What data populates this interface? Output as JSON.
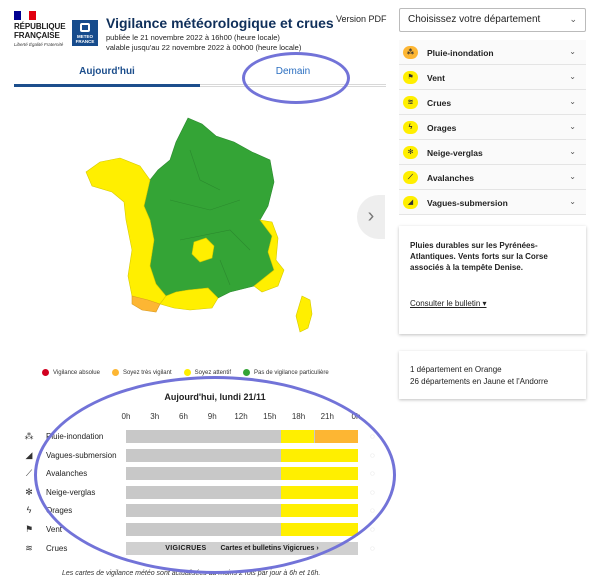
{
  "header": {
    "rf_title_line1": "RÉPUBLIQUE",
    "rf_title_line2": "FRANÇAISE",
    "rf_motto": "Liberté Égalité Fraternité",
    "mf_logo_text": "METEO FRANCE",
    "title": "Vigilance météorologique et crues",
    "published": "publiée le 21 novembre 2022 à 16h00 (heure locale)",
    "valid_until": "valable jusqu'au 22 novembre 2022 à 00h00 (heure locale)",
    "pdf_label": "Version PDF"
  },
  "tabs": {
    "today": "Aujourd'hui",
    "tomorrow": "Demain"
  },
  "legend": {
    "red": {
      "label": "Vigilance absolue",
      "color": "#d1001f"
    },
    "orange": {
      "label": "Soyez très vigilant",
      "color": "#fdb633"
    },
    "yellow": {
      "label": "Soyez attentif",
      "color": "#ffef00"
    },
    "green": {
      "label": "Pas de vigilance particulière",
      "color": "#34a436"
    }
  },
  "timeline": {
    "title": "Aujourd'hui, lundi 21/11",
    "hours": [
      "0h",
      "3h",
      "6h",
      "9h",
      "12h",
      "15h",
      "18h",
      "21h",
      "0h"
    ],
    "rows": [
      {
        "label": "Pluie-inondation",
        "icon": "rain-flood-icon",
        "glyph": "⁂",
        "yellow_from": 16,
        "orange_from": 19.5
      },
      {
        "label": "Vagues-submersion",
        "icon": "waves-submersion-icon",
        "glyph": "◢",
        "yellow_from": 16,
        "orange_from": null
      },
      {
        "label": "Avalanches",
        "icon": "avalanche-icon",
        "glyph": "⟋",
        "yellow_from": 16,
        "orange_from": null
      },
      {
        "label": "Neige-verglas",
        "icon": "snow-ice-icon",
        "glyph": "✻",
        "yellow_from": 16,
        "orange_from": null
      },
      {
        "label": "Orages",
        "icon": "storm-icon",
        "glyph": "ϟ",
        "yellow_from": 16,
        "orange_from": null
      },
      {
        "label": "Vent",
        "icon": "wind-icon",
        "glyph": "⚑",
        "yellow_from": 16,
        "orange_from": null
      }
    ],
    "crues": {
      "label": "Crues",
      "icon": "flood-icon",
      "glyph": "≋",
      "vigicrues": "VIGICRUES",
      "link": "Cartes et bulletins Vigicrues ›"
    },
    "footnote": "Les cartes de vigilance météo sont actualisées au moins 2 fois par jour à 6h et 16h."
  },
  "right_panel": {
    "select_label": "Choisissez votre département",
    "phenomena": [
      {
        "label": "Pluie-inondation",
        "icon": "rain-flood-icon",
        "glyph": "⁂",
        "level": "orange"
      },
      {
        "label": "Vent",
        "icon": "wind-icon",
        "glyph": "⚑",
        "level": "yellow"
      },
      {
        "label": "Crues",
        "icon": "flood-icon",
        "glyph": "≋",
        "level": "yellow"
      },
      {
        "label": "Orages",
        "icon": "storm-icon",
        "glyph": "ϟ",
        "level": "yellow"
      },
      {
        "label": "Neige-verglas",
        "icon": "snow-ice-icon",
        "glyph": "✻",
        "level": "yellow"
      },
      {
        "label": "Avalanches",
        "icon": "avalanche-icon",
        "glyph": "⟋",
        "level": "yellow"
      },
      {
        "label": "Vagues-submersion",
        "icon": "waves-submersion-icon",
        "glyph": "◢",
        "level": "yellow"
      }
    ],
    "bulletin_text": "Pluies durables sur les Pyrénées-Atlantiques. Vents forts sur la Corse associés à la tempête Denise.",
    "bulletin_link": "Consulter le bulletin ▾",
    "count_orange": "1 département en Orange",
    "count_yellow": "26 départements en Jaune et l'Andorre"
  },
  "colors": {
    "green": "#34a436",
    "yellow": "#ffef00",
    "orange": "#fdb633",
    "grey": "#c8c8c8",
    "annotation": "#7273d8"
  }
}
